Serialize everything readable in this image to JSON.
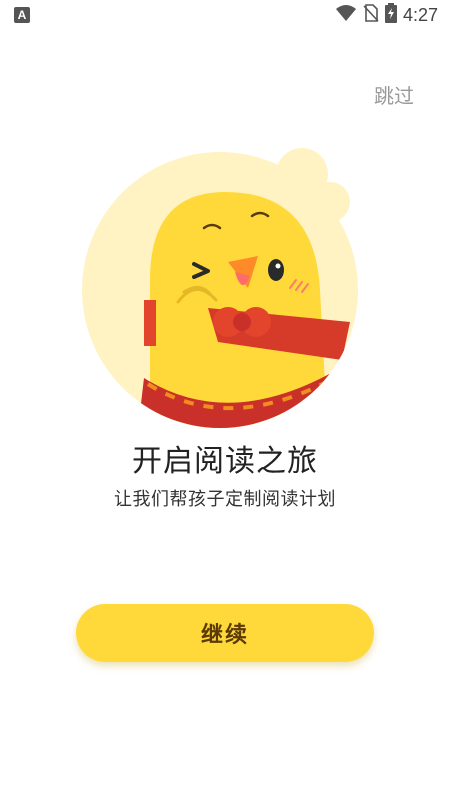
{
  "status_bar": {
    "notification_icon": "A",
    "time": "4:27",
    "icons": [
      "wifi-icon",
      "no-sim-icon",
      "battery-charging-icon"
    ]
  },
  "skip_label": "跳过",
  "illustration": {
    "subject": "chick-mascot-icon",
    "colors": {
      "background_circle": "#fff3c4",
      "chick": "#ffd93a",
      "scarf": "#d63b2a",
      "bow": "#e2442c"
    }
  },
  "title": "开启阅读之旅",
  "subtitle": "让我们帮孩子定制阅读计划",
  "continue_label": "继续",
  "colors": {
    "accent": "#ffd93a",
    "button_text": "#5a3a00",
    "skip_text": "#9a9a9a"
  }
}
